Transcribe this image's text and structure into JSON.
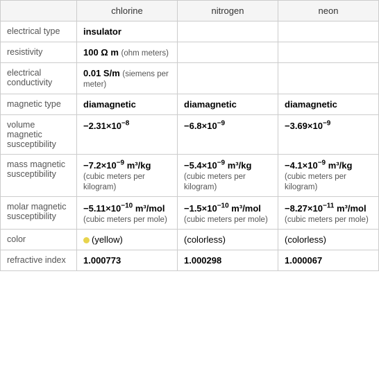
{
  "header": {
    "col1": "chlorine",
    "col2": "nitrogen",
    "col3": "neon"
  },
  "rows": [
    {
      "label": "electrical type",
      "chlorine": {
        "main": "insulator",
        "bold": true,
        "unit": ""
      },
      "nitrogen": {
        "main": "",
        "bold": false,
        "unit": ""
      },
      "neon": {
        "main": "",
        "bold": false,
        "unit": ""
      }
    },
    {
      "label": "resistivity",
      "chlorine": {
        "main": "100 Ω m",
        "bold": true,
        "unit": "(ohm meters)"
      },
      "nitrogen": {
        "main": "",
        "bold": false,
        "unit": ""
      },
      "neon": {
        "main": "",
        "bold": false,
        "unit": ""
      }
    },
    {
      "label": "electrical conductivity",
      "chlorine": {
        "main": "0.01 S/m",
        "bold": true,
        "unit": "(siemens per meter)"
      },
      "nitrogen": {
        "main": "",
        "bold": false,
        "unit": ""
      },
      "neon": {
        "main": "",
        "bold": false,
        "unit": ""
      }
    },
    {
      "label": "magnetic type",
      "chlorine": {
        "main": "diamagnetic",
        "bold": true,
        "unit": ""
      },
      "nitrogen": {
        "main": "diamagnetic",
        "bold": true,
        "unit": ""
      },
      "neon": {
        "main": "diamagnetic",
        "bold": true,
        "unit": ""
      }
    },
    {
      "label": "volume magnetic susceptibility",
      "chlorine": {
        "main": "−2.31×10⁻⁸",
        "bold": true,
        "unit": ""
      },
      "nitrogen": {
        "main": "−6.8×10⁻⁹",
        "bold": true,
        "unit": ""
      },
      "neon": {
        "main": "−3.69×10⁻⁹",
        "bold": true,
        "unit": ""
      }
    },
    {
      "label": "mass magnetic susceptibility",
      "chlorine": {
        "main": "−7.2×10⁻⁹ m³/kg",
        "bold": true,
        "unit": "(cubic meters per kilogram)"
      },
      "nitrogen": {
        "main": "−5.4×10⁻⁹ m³/kg",
        "bold": true,
        "unit": "(cubic meters per kilogram)"
      },
      "neon": {
        "main": "−4.1×10⁻⁹ m³/kg",
        "bold": true,
        "unit": "(cubic meters per kilogram)"
      }
    },
    {
      "label": "molar magnetic susceptibility",
      "chlorine": {
        "main": "−5.11×10⁻¹⁰ m³/mol",
        "bold": true,
        "unit": "(cubic meters per mole)"
      },
      "nitrogen": {
        "main": "−1.5×10⁻¹⁰ m³/mol",
        "bold": true,
        "unit": "(cubic meters per mole)"
      },
      "neon": {
        "main": "−8.27×10⁻¹¹ m³/mol",
        "bold": true,
        "unit": "(cubic meters per mole)"
      }
    },
    {
      "label": "color",
      "chlorine": {
        "main": "(yellow)",
        "bold": false,
        "unit": "",
        "dot": true,
        "dotColor": "#e8d44d"
      },
      "nitrogen": {
        "main": "(colorless)",
        "bold": false,
        "unit": ""
      },
      "neon": {
        "main": "(colorless)",
        "bold": false,
        "unit": ""
      }
    },
    {
      "label": "refractive index",
      "chlorine": {
        "main": "1.000773",
        "bold": true,
        "unit": ""
      },
      "nitrogen": {
        "main": "1.000298",
        "bold": true,
        "unit": ""
      },
      "neon": {
        "main": "1.000067",
        "bold": true,
        "unit": ""
      }
    }
  ]
}
